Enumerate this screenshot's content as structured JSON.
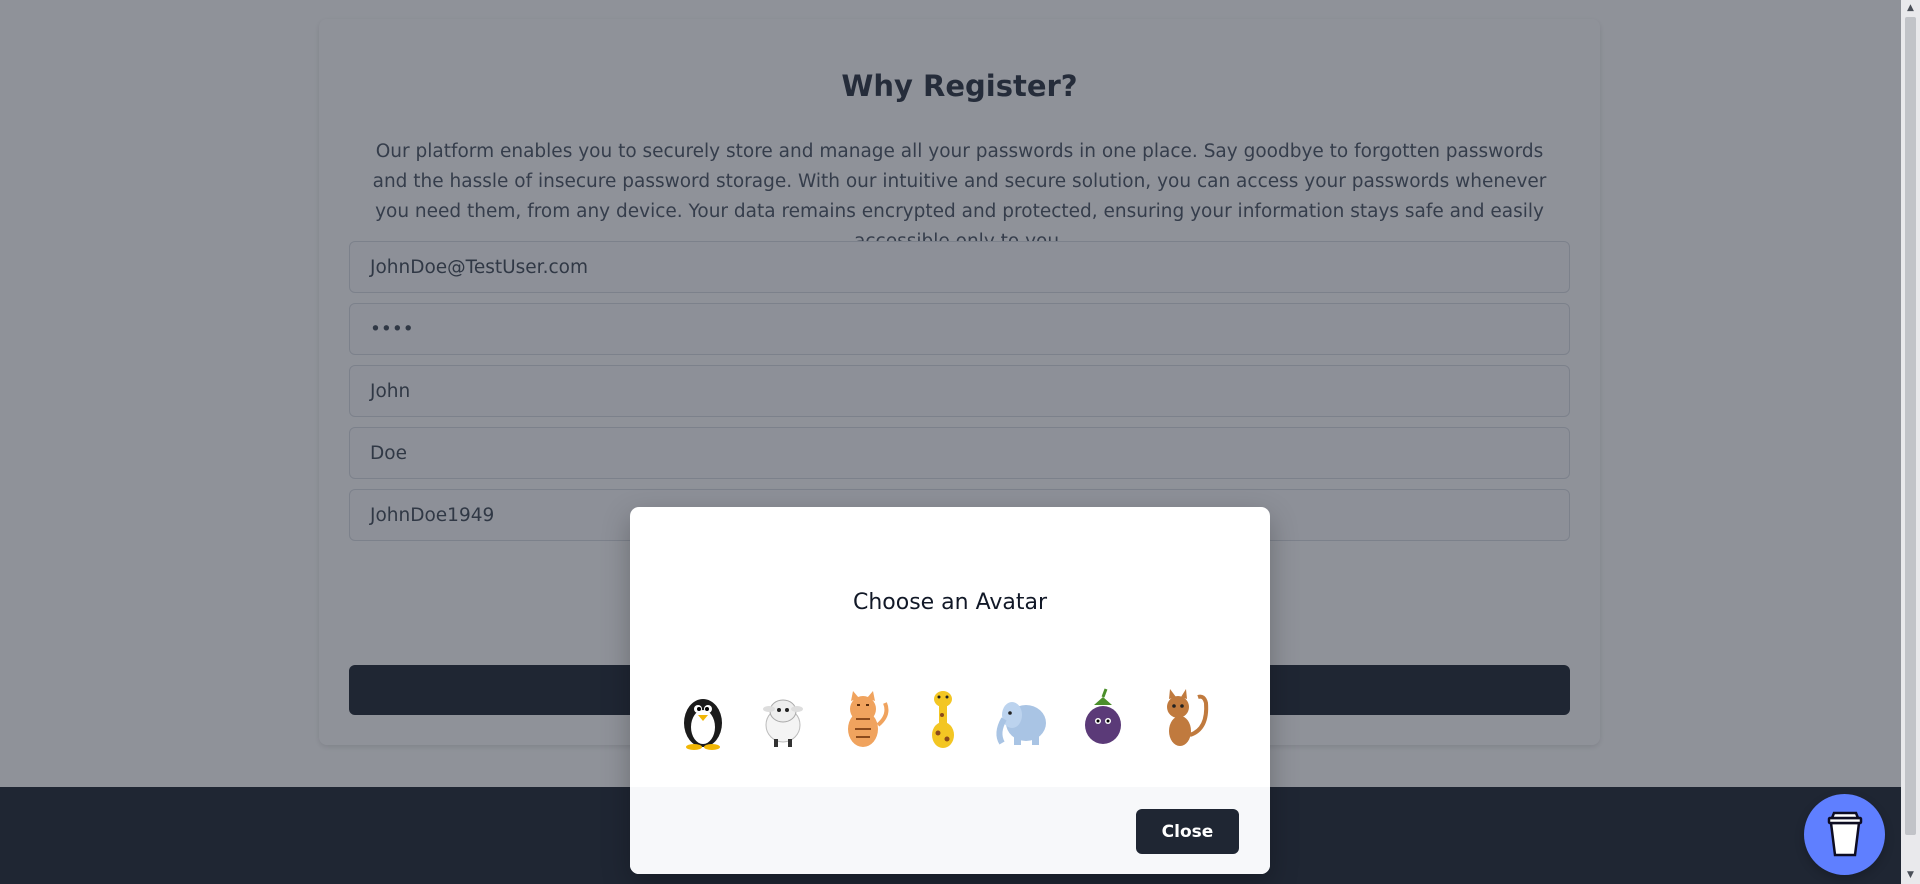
{
  "register_card": {
    "title": "Why Register?",
    "description": "Our platform enables you to securely store and manage all your passwords in one place. Say goodbye to forgotten passwords and the hassle of insecure password storage. With our intuitive and secure solution, you can access your passwords whenever you need them, from any device. Your data remains encrypted and protected, ensuring your information stays safe and easily accessible only to you.",
    "fields": {
      "email": "JohnDoe@TestUser.com",
      "password": "••••",
      "first_name": "John",
      "last_name": "Doe",
      "username": "JohnDoe1949"
    }
  },
  "modal": {
    "title": "Choose an Avatar",
    "avatars": [
      "penguin",
      "sheep",
      "tiger-cat",
      "giraffe",
      "elephant",
      "eggplant",
      "cat"
    ],
    "close_label": "Close"
  },
  "colors": {
    "primary_dark": "#1f2633",
    "coffee_button": "#5f7fff",
    "overlay": "rgba(31,38,51,0.5)"
  }
}
